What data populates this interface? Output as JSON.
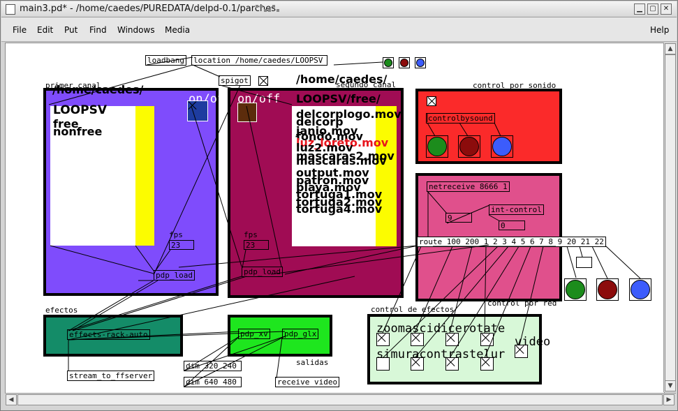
{
  "window": {
    "title": "main3.pd* - /home/caedes/PUREDATA/delpd-0.1/parches",
    "buttons": {
      "minimize": "▁",
      "maximize": "▢",
      "close": "✕"
    }
  },
  "menubar": {
    "items": [
      "File",
      "Edit",
      "Put",
      "Find",
      "Windows",
      "Media",
      "Help"
    ]
  },
  "patch": {
    "loadbang": "loadbang",
    "location_msg": "location /home/caedes/LOOPSV",
    "spigot": "spigot",
    "path_label": "/home/caedes/",
    "primer": {
      "label": "primer canal",
      "path": "/home/caedes/",
      "onoff": "on/off",
      "list": [
        "LOOPSV",
        "free",
        "nonfree"
      ],
      "fps_label": "fps",
      "fps_value": "23",
      "load": "pdp_load"
    },
    "segundo": {
      "label": "segundo canal",
      "onoff": "on/off",
      "path": "LOOPSV/free/",
      "files": [
        "delcorplogo.mov",
        "delcorp",
        "janio.mov",
        "fondo.mov",
        "luz_loreto.mov",
        "luz2.mov",
        "mascaras2.mov",
        "mascaras.mov",
        "output.mov",
        "patron.mov",
        "playa.mov",
        "tortuga1.mov",
        "tortuga2.mov",
        "tortuga4.mov"
      ],
      "fps_label": "fps",
      "fps_value": "23",
      "load": "pdp_load"
    },
    "sonido": {
      "label": "control por sonido",
      "object": "controlbysound"
    },
    "red": {
      "label": "control por red",
      "netreceive": "netreceive 8666 1",
      "num1": "9",
      "intcontrol": "int-control",
      "num2": "0",
      "route": "route 100 200 1 2 3 4 5 6 7 8 9 20 21 22"
    },
    "efectos": {
      "label": "efectos",
      "rack": "effects-rack-auto",
      "stream": "stream_to_ffserver"
    },
    "salidas": {
      "label": "salidas",
      "xv": "pdp_xv",
      "glx": "pdp_glx",
      "dim1": "dim 320 240",
      "dim2": "dim 640 480",
      "receive": "receive video"
    },
    "control_efectos": {
      "label": "control de efectos",
      "row1": "zoomascidicerotate",
      "video": "video",
      "row2": "simuracontrastelur"
    }
  },
  "colors": {
    "primer_panel": "#7f4cfc",
    "segundo_panel": "#a00c54",
    "sonido_panel": "#fb2a2a",
    "red_panel": "#e0508c",
    "efectos_panel": "#148c68",
    "salidas_panel": "#1ee61e",
    "control_efectos_panel": "#d8f8d8",
    "green_bang": "#1c8c1c",
    "red_bang": "#8c0c0c",
    "blue_bang": "#3c5cfc",
    "yellow_bar": "#fcfc00"
  }
}
